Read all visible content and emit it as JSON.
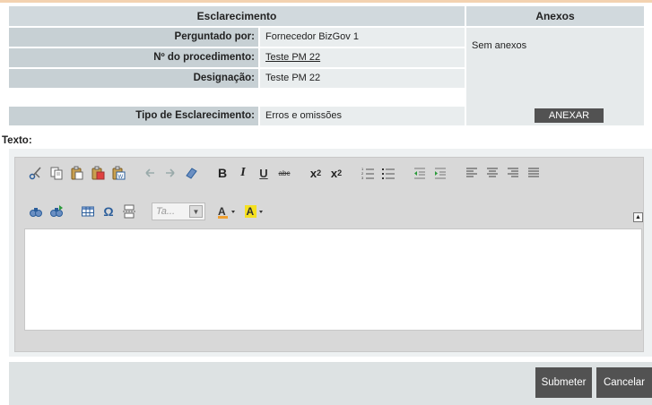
{
  "header": {
    "esclarecimento": "Esclarecimento",
    "anexos": "Anexos"
  },
  "fields": [
    {
      "label": "Perguntado por:",
      "value": "Fornecedor BizGov 1"
    },
    {
      "label": "Nº do procedimento:",
      "value": "Teste PM 22"
    },
    {
      "label": "Designação:",
      "value": "Teste PM 22"
    },
    {
      "label": "Tipo de Esclarecimento:",
      "value": "Erros e omissões"
    }
  ],
  "anexos": {
    "empty_text": "Sem anexos",
    "button": "ANEXAR"
  },
  "texto_label": "Texto:",
  "editor": {
    "font_placeholder": "Ta...",
    "content": ""
  },
  "actions": {
    "submit": "Submeter",
    "cancel": "Cancelar"
  },
  "colors": {
    "accent_dark": "#525252",
    "header_bg": "#d1d9dd",
    "label_bg": "#c7d0d4",
    "value_bg": "#e9edee",
    "top_line": "#f3d2b0"
  }
}
